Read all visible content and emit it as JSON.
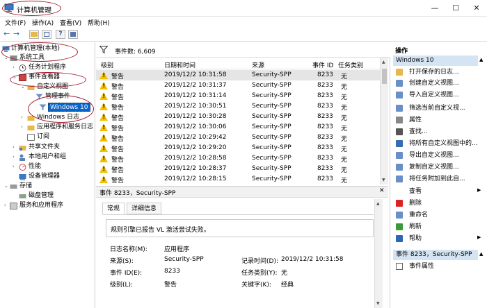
{
  "window": {
    "title": "计算机管理",
    "minimize": "—",
    "maximize": "☐",
    "close": "✕"
  },
  "menu": [
    "文件(F)",
    "操作(A)",
    "查看(V)",
    "帮助(H)"
  ],
  "toolbar": {
    "back": "←",
    "forward": "→"
  },
  "tree": {
    "root": "计算机管理(本地)",
    "system_tools": "系统工具",
    "task_scheduler": "任务计划程序",
    "event_viewer": "事件查看器",
    "custom_views": "自定义视图",
    "admin_events": "管理事件",
    "windows10": "Windows 10",
    "windows_logs": "Windows 日志",
    "app_service_logs": "应用程序和服务日志",
    "subscriptions": "订阅",
    "shared_folders": "共享文件夹",
    "local_users": "本地用户和组",
    "performance": "性能",
    "device_manager": "设备管理器",
    "storage": "存储",
    "disk_management": "磁盘管理",
    "services_apps": "服务和应用程序"
  },
  "events": {
    "count_label": "事件数: 6,609",
    "columns": [
      "级别",
      "日期和时间",
      "来源",
      "事件 ID",
      "任务类别"
    ],
    "rows": [
      {
        "level": "警告",
        "datetime": "2019/12/2 10:31:58",
        "source": "Security-SPP",
        "id": "8233",
        "category": "无"
      },
      {
        "level": "警告",
        "datetime": "2019/12/2 10:31:37",
        "source": "Security-SPP",
        "id": "8233",
        "category": "无"
      },
      {
        "level": "警告",
        "datetime": "2019/12/2 10:31:14",
        "source": "Security-SPP",
        "id": "8233",
        "category": "无"
      },
      {
        "level": "警告",
        "datetime": "2019/12/2 10:30:51",
        "source": "Security-SPP",
        "id": "8233",
        "category": "无"
      },
      {
        "level": "警告",
        "datetime": "2019/12/2 10:30:28",
        "source": "Security-SPP",
        "id": "8233",
        "category": "无"
      },
      {
        "level": "警告",
        "datetime": "2019/12/2 10:30:06",
        "source": "Security-SPP",
        "id": "8233",
        "category": "无"
      },
      {
        "level": "警告",
        "datetime": "2019/12/2 10:29:42",
        "source": "Security-SPP",
        "id": "8233",
        "category": "无"
      },
      {
        "level": "警告",
        "datetime": "2019/12/2 10:29:20",
        "source": "Security-SPP",
        "id": "8233",
        "category": "无"
      },
      {
        "level": "警告",
        "datetime": "2019/12/2 10:28:58",
        "source": "Security-SPP",
        "id": "8233",
        "category": "无"
      },
      {
        "level": "警告",
        "datetime": "2019/12/2 10:28:37",
        "source": "Security-SPP",
        "id": "8233",
        "category": "无"
      },
      {
        "level": "警告",
        "datetime": "2019/12/2 10:28:15",
        "source": "Security-SPP",
        "id": "8233",
        "category": "无"
      }
    ]
  },
  "detail": {
    "title": "事件 8233，Security-SPP",
    "close": "✕",
    "tab_general": "常规",
    "tab_details": "详细信息",
    "message": "规则引擎已报告 VL 激活尝试失败。",
    "log_name_label": "日志名称(M):",
    "log_name": "应用程序",
    "source_label": "来源(S):",
    "source": "Security-SPP",
    "logged_label": "记录时间(D):",
    "logged": "2019/12/2 10:31:58",
    "event_id_label": "事件 ID(E):",
    "event_id": "8233",
    "task_label": "任务类别(Y):",
    "task": "无",
    "level_label": "级别(L):",
    "level": "警告",
    "keywords_label": "关键字(K):",
    "keywords": "经典"
  },
  "actions": {
    "title": "操作",
    "section1": "Windows 10",
    "items1": [
      "打开保存的日志...",
      "创建自定义视图...",
      "导入自定义视图...",
      "筛选当前自定义视...",
      "属性",
      "查找...",
      "将所有自定义视图中的...",
      "导出自定义视图...",
      "复制自定义视图...",
      "将任务附加到此自...",
      "查看",
      "删除",
      "重命名",
      "刷新",
      "帮助"
    ],
    "section2": "事件 8233，Security-SPP",
    "items2": [
      "事件属性"
    ]
  }
}
